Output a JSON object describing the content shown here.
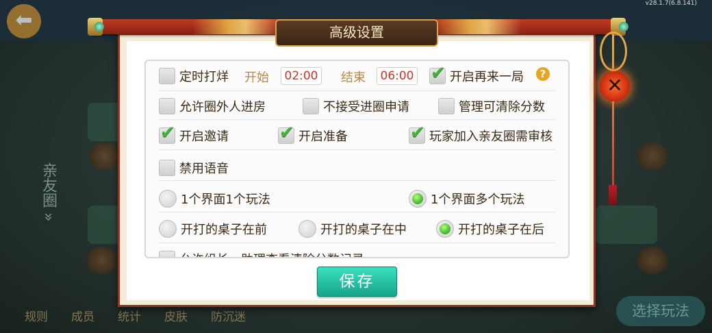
{
  "version": "v28.1.7(6.8.141)",
  "dialog": {
    "title": "高级设置",
    "close_icon": "✕"
  },
  "background": {
    "side_tab": "亲友圈 »",
    "bottom_nav": [
      "规则",
      "成员",
      "统计",
      "皮肤",
      "防沉迷"
    ],
    "choose_play": "选择玩法"
  },
  "timed": {
    "label": "定时打烊",
    "start_label": "开始",
    "start_value": "02:00",
    "end_label": "结束",
    "end_value": "06:00"
  },
  "replay": {
    "label": "开启再来一局",
    "help_icon": "?"
  },
  "options": {
    "allow_outsiders": "允许圈外人进房",
    "refuse_join": "不接受进圈申请",
    "admin_clear": "管理可清除分数",
    "invite": "开启邀请",
    "ready": "开启准备",
    "join_review": "玩家加入亲友圈需审核",
    "disable_voice": "禁用语音",
    "single_mode": "1个界面1个玩法",
    "multi_mode": "1个界面多个玩法",
    "table_front": "开打的桌子在前",
    "table_middle": "开打的桌子在中",
    "table_back": "开打的桌子在后",
    "cut_off_row": "允许组长、助理查看清除分数记录"
  },
  "save_label": "保存"
}
